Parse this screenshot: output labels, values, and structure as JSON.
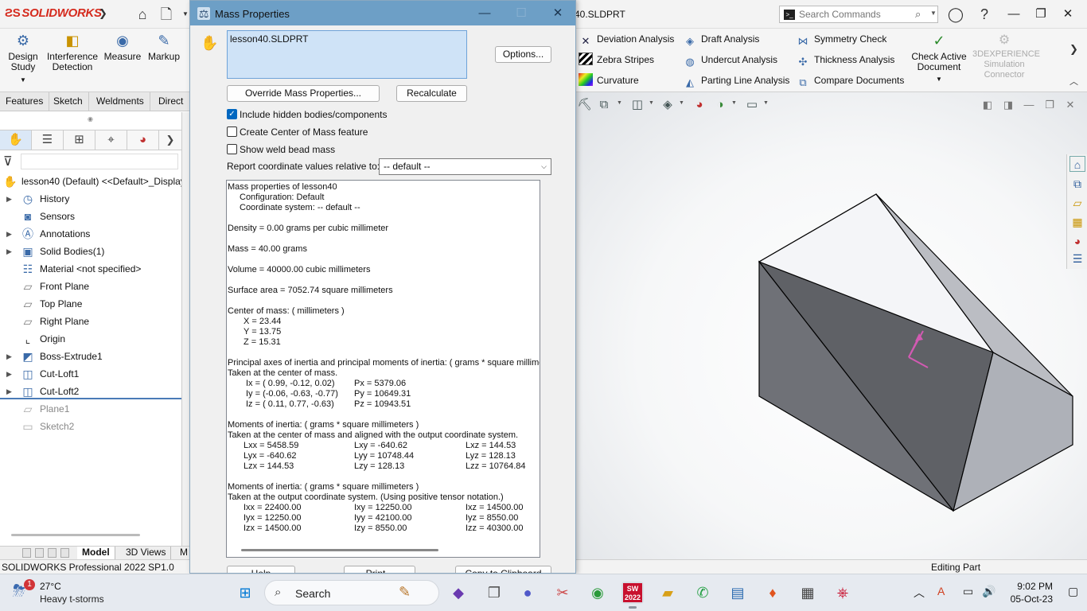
{
  "app": {
    "brand": "SOLIDWORKS",
    "document_title": "40.SLDPRT",
    "search": {
      "placeholder": "Search Commands"
    }
  },
  "ribbon": {
    "big_buttons": [
      {
        "label": "Design Study",
        "icon": "design-study-icon"
      },
      {
        "label": "Interference Detection",
        "icon": "interference-icon"
      },
      {
        "label": "Measure",
        "icon": "measure-icon"
      },
      {
        "label": "Markup",
        "icon": "markup-icon"
      }
    ],
    "evaluate_tools": [
      {
        "label": "Deviation Analysis",
        "icon": "deviation-icon"
      },
      {
        "label": "Zebra Stripes",
        "icon": "zebra-icon"
      },
      {
        "label": "Curvature",
        "icon": "curvature-icon"
      },
      {
        "label": "Draft Analysis",
        "icon": "draft-icon"
      },
      {
        "label": "Undercut Analysis",
        "icon": "undercut-icon"
      },
      {
        "label": "Parting Line Analysis",
        "icon": "parting-line-icon"
      },
      {
        "label": "Symmetry Check",
        "icon": "symmetry-icon"
      },
      {
        "label": "Thickness Analysis",
        "icon": "thickness-icon"
      },
      {
        "label": "Compare Documents",
        "icon": "compare-icon"
      }
    ],
    "check_active": "Check Active Document",
    "experience": "3DEXPERIENCE Simulation Connector"
  },
  "command_tabs": [
    "Features",
    "Sketch",
    "Weldments",
    "Direct E"
  ],
  "feature_tree": {
    "root": "lesson40 (Default) <<Default>_Display",
    "items": [
      {
        "label": "History",
        "expandable": true
      },
      {
        "label": "Sensors",
        "expandable": false
      },
      {
        "label": "Annotations",
        "expandable": true
      },
      {
        "label": "Solid Bodies(1)",
        "expandable": true
      },
      {
        "label": "Material <not specified>",
        "expandable": false
      },
      {
        "label": "Front Plane",
        "expandable": false
      },
      {
        "label": "Top Plane",
        "expandable": false
      },
      {
        "label": "Right Plane",
        "expandable": false
      },
      {
        "label": "Origin",
        "expandable": false
      },
      {
        "label": "Boss-Extrude1",
        "expandable": true
      },
      {
        "label": "Cut-Loft1",
        "expandable": true
      },
      {
        "label": "Cut-Loft2",
        "expandable": true
      },
      {
        "label": "Plane1",
        "expandable": false
      },
      {
        "label": "Sketch2",
        "expandable": false
      }
    ]
  },
  "bottom_tabs": [
    "Model",
    "3D Views",
    "M"
  ],
  "status": {
    "left": "SOLIDWORKS Professional 2022 SP1.0",
    "right": "Editing Part"
  },
  "dialog": {
    "title": "Mass Properties",
    "selection": "lesson40.SLDPRT",
    "options_button": "Options...",
    "override_button": "Override Mass Properties...",
    "recalculate_button": "Recalculate",
    "include_hidden": {
      "label": "Include hidden bodies/components",
      "checked": true
    },
    "create_com": {
      "label": "Create Center of Mass feature",
      "checked": false
    },
    "show_weld": {
      "label": "Show weld bead mass",
      "checked": false
    },
    "coord_label": "Report coordinate values relative to:",
    "coord_value": "-- default --",
    "report": {
      "l1": "Mass properties of lesson40",
      "l2": "Configuration: Default",
      "l3": "Coordinate system: -- default --",
      "density": "Density = 0.00 grams per cubic millimeter",
      "mass": "Mass = 40.00 grams",
      "volume": "Volume = 40000.00 cubic millimeters",
      "surface": "Surface area = 7052.74  square millimeters",
      "com_title": "Center of mass: ( millimeters )",
      "com_x": "X = 23.44",
      "com_y": "Y = 13.75",
      "com_z": "Z = 15.31",
      "pa_title": "Principal axes of inertia and principal moments of inertia: ( grams *  square millimeters )",
      "pa_sub": "Taken at the center of mass.",
      "ix": "Ix = ( 0.99, -0.12,  0.02)",
      "iy": "Iy = (-0.06, -0.63, -0.77)",
      "iz": "Iz = ( 0.11,  0.77, -0.63)",
      "px": "Px = 5379.06",
      "py": "Py = 10649.31",
      "pz": "Pz = 10943.51",
      "mi_title": "Moments of inertia: ( grams *  square millimeters )",
      "mi_sub": "Taken at the center of mass and aligned with the output coordinate system.",
      "lxx": "Lxx = 5458.59",
      "lxy": "Lxy = -640.62",
      "lxz": "Lxz = 144.53",
      "lyx": "Lyx = -640.62",
      "lyy": "Lyy = 10748.44",
      "lyz": "Lyz = 128.13",
      "lzx": "Lzx = 144.53",
      "lzy": "Lzy = 128.13",
      "lzz": "Lzz = 10764.84",
      "mo_title": "Moments of inertia: ( grams *  square millimeters )",
      "mo_sub": "Taken at the output coordinate system. (Using positive tensor notation.)",
      "ixx": "Ixx = 22400.00",
      "ixy": "Ixy = 12250.00",
      "ixz": "Ixz = 14500.00",
      "iyx": "Iyx = 12250.00",
      "iyy": "Iyy = 42100.00",
      "iyz": "Iyz = 8550.00",
      "izx": "Izx = 14500.00",
      "izy": "Izy = 8550.00",
      "izz": "Izz = 40300.00"
    },
    "help_button": "Help",
    "print_button": "Print...",
    "copy_button": "Copy to Clipboard"
  },
  "taskbar": {
    "weather_badge": "1",
    "temperature": "27°C",
    "weather": "Heavy t-storms",
    "search": "Search",
    "sw_badge": "2022",
    "time": "9:02 PM",
    "date": "05-Oct-23"
  }
}
